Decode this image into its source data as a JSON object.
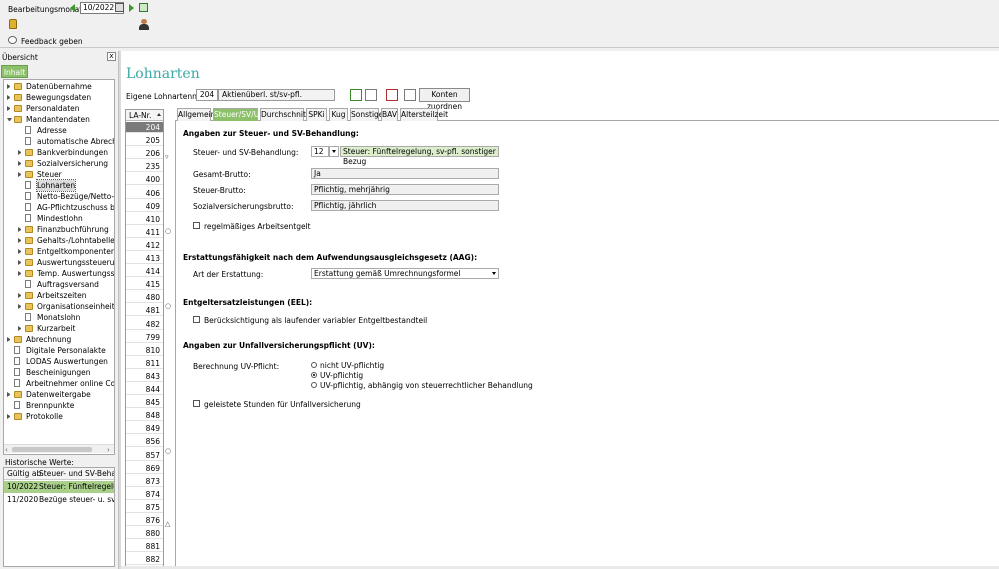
{
  "toolbar": {
    "month_label": "Bearbeitungsmonat:",
    "month_value": "10/2022",
    "feedback_label": "Feedback geben"
  },
  "overview": {
    "title": "Übersicht",
    "close": "x",
    "tab_inhalt": "Inhalt",
    "tree": [
      {
        "label": "Datenübernahme",
        "level": 0,
        "type": "folder",
        "expand": "closed"
      },
      {
        "label": "Bewegungsdaten",
        "level": 0,
        "type": "folder",
        "expand": "closed"
      },
      {
        "label": "Personaldaten",
        "level": 0,
        "type": "folder",
        "expand": "closed"
      },
      {
        "label": "Mandantendaten",
        "level": 0,
        "type": "folder",
        "expand": "open"
      },
      {
        "label": "Adresse",
        "level": 1,
        "type": "doc",
        "expand": "none"
      },
      {
        "label": "automatische Abrechnung",
        "level": 1,
        "type": "doc",
        "expand": "none"
      },
      {
        "label": "Bankverbindungen",
        "level": 1,
        "type": "folder",
        "expand": "closed"
      },
      {
        "label": "Sozialversicherung",
        "level": 1,
        "type": "folder",
        "expand": "closed"
      },
      {
        "label": "Steuer",
        "level": 1,
        "type": "folder",
        "expand": "closed"
      },
      {
        "label": "Lohnarten",
        "level": 1,
        "type": "doc",
        "expand": "none",
        "selected": true
      },
      {
        "label": "Netto-Bezüge/Netto-Abzüge",
        "level": 1,
        "type": "doc",
        "expand": "none"
      },
      {
        "label": "AG-Pflichtzuschuss bAV",
        "level": 1,
        "type": "doc",
        "expand": "none"
      },
      {
        "label": "Mindestlohn",
        "level": 1,
        "type": "doc",
        "expand": "none"
      },
      {
        "label": "Finanzbuchführung",
        "level": 1,
        "type": "folder",
        "expand": "closed"
      },
      {
        "label": "Gehalts-/Lohntabellen",
        "level": 1,
        "type": "folder",
        "expand": "closed"
      },
      {
        "label": "Entgeltkomponenten",
        "level": 1,
        "type": "folder",
        "expand": "closed"
      },
      {
        "label": "Auswertungssteuerung",
        "level": 1,
        "type": "folder",
        "expand": "closed"
      },
      {
        "label": "Temp. Auswertungssteuerung",
        "level": 1,
        "type": "folder",
        "expand": "closed"
      },
      {
        "label": "Auftragsversand",
        "level": 1,
        "type": "doc",
        "expand": "none"
      },
      {
        "label": "Arbeitszeiten",
        "level": 1,
        "type": "folder",
        "expand": "closed"
      },
      {
        "label": "Organisationseinheiten",
        "level": 1,
        "type": "folder",
        "expand": "closed"
      },
      {
        "label": "Monatslohn",
        "level": 1,
        "type": "doc",
        "expand": "none"
      },
      {
        "label": "Kurzarbeit",
        "level": 1,
        "type": "folder",
        "expand": "closed"
      },
      {
        "label": "Abrechnung",
        "level": 0,
        "type": "folder",
        "expand": "closed"
      },
      {
        "label": "Digitale Personalakte",
        "level": 0,
        "type": "doc",
        "expand": "none"
      },
      {
        "label": "LODAS Auswertungen",
        "level": 0,
        "type": "doc",
        "expand": "none"
      },
      {
        "label": "Bescheinigungen",
        "level": 0,
        "type": "doc",
        "expand": "none"
      },
      {
        "label": "Arbeitnehmer online Cockpit",
        "level": 0,
        "type": "doc",
        "expand": "none"
      },
      {
        "label": "Datenweitergabe",
        "level": 0,
        "type": "folder",
        "expand": "closed"
      },
      {
        "label": "Brennpunkte",
        "level": 0,
        "type": "doc",
        "expand": "none"
      },
      {
        "label": "Protokolle",
        "level": 0,
        "type": "folder",
        "expand": "closed"
      }
    ]
  },
  "history": {
    "title": "Historische Werte:",
    "col_date": "Gültig ab",
    "col_value": "Steuer- und SV-Behandlung",
    "rows": [
      {
        "date": "10/2022",
        "value": "Steuer: Fünftelregelung, sv-pfl. sonstiger Bezug",
        "selected": true
      },
      {
        "date": "11/2020",
        "value": "Bezüge steuer- u. sv-pflichtig",
        "selected": false
      }
    ]
  },
  "page": {
    "title": "Lohnarten",
    "own_number_label": "Eigene Lohnartennummer:",
    "own_number": "204",
    "own_name": "Aktienüberl. st/sv-pfl.",
    "konten_button": "Konten zuordnen"
  },
  "la_list": {
    "header": "LA-Nr.",
    "items": [
      "204",
      "205",
      "206",
      "235",
      "400",
      "406",
      "409",
      "410",
      "411",
      "412",
      "413",
      "414",
      "415",
      "480",
      "481",
      "482",
      "799",
      "810",
      "811",
      "843",
      "844",
      "845",
      "848",
      "849",
      "856",
      "857",
      "869",
      "873",
      "874",
      "875",
      "876",
      "880",
      "881",
      "882"
    ],
    "selected_index": 0
  },
  "tabs": [
    "Allgemein",
    "Steuer/SV/UV",
    "Durchschnitte",
    "SPKi",
    "Kug",
    "Sonstiges",
    "BAV",
    "Altersteilzeit"
  ],
  "active_tab": 1,
  "form": {
    "section_tax": "Angaben zur Steuer- und SV-Behandlung:",
    "tax_treatment_label": "Steuer- und SV-Behandlung:",
    "tax_treatment_code": "12",
    "tax_treatment_text": "Steuer: Fünftelregelung, sv-pfl. sonstiger Bezug",
    "gesamt_label": "Gesamt-Brutto:",
    "gesamt_value": "Ja",
    "steuer_label": "Steuer-Brutto:",
    "steuer_value": "Pflichtig, mehrjährig",
    "sv_label": "Sozialversicherungsbrutto:",
    "sv_value": "Pflichtig, jährlich",
    "regular_label": "regelmäßiges Arbeitsentgelt",
    "section_aag": "Erstattungsfähigkeit nach dem Aufwendungsausgleichsgesetz (AAG):",
    "art_label": "Art der Erstattung:",
    "art_value": "Erstattung gemäß Umrechnungsformel",
    "section_eel": "Entgeltersatzleistungen (EEL):",
    "eel_label": "Berücksichtigung als laufender variabler Entgeltbestandteil",
    "section_uv": "Angaben zur Unfallversicherungspflicht (UV):",
    "uv_label": "Berechnung UV-Pflicht:",
    "uv_options": [
      "nicht UV-pflichtig",
      "UV-pflichtig",
      "UV-pflichtig, abhängig von steuerrechtlicher Behandlung"
    ],
    "uv_selected": 1,
    "hours_label": "geleistete Stunden für Unfallversicherung"
  }
}
